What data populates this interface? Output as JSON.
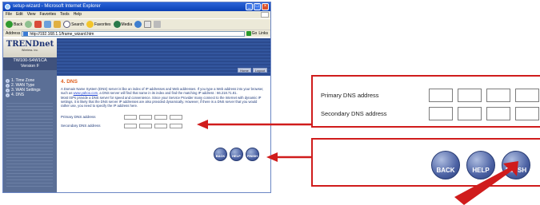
{
  "window": {
    "title": "setup-wizard - Microsoft Internet Explorer"
  },
  "menu": [
    "File",
    "Edit",
    "View",
    "Favorites",
    "Tools",
    "Help"
  ],
  "toolbar": {
    "back": "Back",
    "search": "Search",
    "favorites": "Favorites",
    "media": "Media"
  },
  "address": {
    "label": "Address",
    "url": "http://192.168.1.1/frame_wizard.htm",
    "go": "Go",
    "links": "Links"
  },
  "logo": {
    "brand": "TRENDnet",
    "tagline": "Wireless. Inc."
  },
  "model": {
    "name": "TW100-S4W1CA",
    "version": "Version F"
  },
  "steps": [
    "1. Time Zone",
    "2. WAN Type",
    "3. WAN Settings",
    "4. DNS"
  ],
  "header_buttons": [
    "Home",
    "Logout"
  ],
  "section": {
    "title": "4. DNS",
    "para1_pre": "A Domain Name System (DNS) server is like an index of IP addresses and Web addresses. If you type a Web address into your browser, such as ",
    "para1_link": "www.yahoo.com",
    "para1_post": ", a DNS server will find that name in its index and find the matching IP address : 66.218.71.81.",
    "para2": "Most ISPs provide a DNS server for speed and convenience. Since your Service Provider many connect to the Internet with dynamic IP settings, it is likely that the DNS server IP addresses are also provided dynamically. However, if there is a DNS server that you would rather use, you need to specify the IP address here."
  },
  "form": {
    "primary_label": "Primary DNS address",
    "secondary_label": "Secondary DNS address"
  },
  "nav": {
    "back": "BACK",
    "help": "HELP",
    "finish": "FINISH"
  },
  "callout": {
    "primary_label": "Primary DNS address",
    "secondary_label": "Secondary DNS address"
  },
  "colors": {
    "callout_red": "#d01c1c",
    "heading_orange": "#e06020",
    "banner_blue": "#2b4a8e",
    "sidebar": "#5b6f96"
  }
}
